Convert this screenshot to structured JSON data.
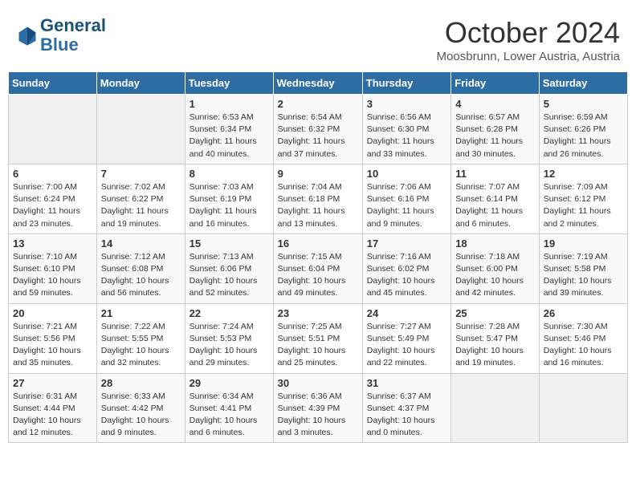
{
  "header": {
    "logo_line1": "General",
    "logo_line2": "Blue",
    "month": "October 2024",
    "location": "Moosbrunn, Lower Austria, Austria"
  },
  "days_of_week": [
    "Sunday",
    "Monday",
    "Tuesday",
    "Wednesday",
    "Thursday",
    "Friday",
    "Saturday"
  ],
  "weeks": [
    [
      {
        "day": "",
        "info": ""
      },
      {
        "day": "",
        "info": ""
      },
      {
        "day": "1",
        "info": "Sunrise: 6:53 AM\nSunset: 6:34 PM\nDaylight: 11 hours and 40 minutes."
      },
      {
        "day": "2",
        "info": "Sunrise: 6:54 AM\nSunset: 6:32 PM\nDaylight: 11 hours and 37 minutes."
      },
      {
        "day": "3",
        "info": "Sunrise: 6:56 AM\nSunset: 6:30 PM\nDaylight: 11 hours and 33 minutes."
      },
      {
        "day": "4",
        "info": "Sunrise: 6:57 AM\nSunset: 6:28 PM\nDaylight: 11 hours and 30 minutes."
      },
      {
        "day": "5",
        "info": "Sunrise: 6:59 AM\nSunset: 6:26 PM\nDaylight: 11 hours and 26 minutes."
      }
    ],
    [
      {
        "day": "6",
        "info": "Sunrise: 7:00 AM\nSunset: 6:24 PM\nDaylight: 11 hours and 23 minutes."
      },
      {
        "day": "7",
        "info": "Sunrise: 7:02 AM\nSunset: 6:22 PM\nDaylight: 11 hours and 19 minutes."
      },
      {
        "day": "8",
        "info": "Sunrise: 7:03 AM\nSunset: 6:19 PM\nDaylight: 11 hours and 16 minutes."
      },
      {
        "day": "9",
        "info": "Sunrise: 7:04 AM\nSunset: 6:18 PM\nDaylight: 11 hours and 13 minutes."
      },
      {
        "day": "10",
        "info": "Sunrise: 7:06 AM\nSunset: 6:16 PM\nDaylight: 11 hours and 9 minutes."
      },
      {
        "day": "11",
        "info": "Sunrise: 7:07 AM\nSunset: 6:14 PM\nDaylight: 11 hours and 6 minutes."
      },
      {
        "day": "12",
        "info": "Sunrise: 7:09 AM\nSunset: 6:12 PM\nDaylight: 11 hours and 2 minutes."
      }
    ],
    [
      {
        "day": "13",
        "info": "Sunrise: 7:10 AM\nSunset: 6:10 PM\nDaylight: 10 hours and 59 minutes."
      },
      {
        "day": "14",
        "info": "Sunrise: 7:12 AM\nSunset: 6:08 PM\nDaylight: 10 hours and 56 minutes."
      },
      {
        "day": "15",
        "info": "Sunrise: 7:13 AM\nSunset: 6:06 PM\nDaylight: 10 hours and 52 minutes."
      },
      {
        "day": "16",
        "info": "Sunrise: 7:15 AM\nSunset: 6:04 PM\nDaylight: 10 hours and 49 minutes."
      },
      {
        "day": "17",
        "info": "Sunrise: 7:16 AM\nSunset: 6:02 PM\nDaylight: 10 hours and 45 minutes."
      },
      {
        "day": "18",
        "info": "Sunrise: 7:18 AM\nSunset: 6:00 PM\nDaylight: 10 hours and 42 minutes."
      },
      {
        "day": "19",
        "info": "Sunrise: 7:19 AM\nSunset: 5:58 PM\nDaylight: 10 hours and 39 minutes."
      }
    ],
    [
      {
        "day": "20",
        "info": "Sunrise: 7:21 AM\nSunset: 5:56 PM\nDaylight: 10 hours and 35 minutes."
      },
      {
        "day": "21",
        "info": "Sunrise: 7:22 AM\nSunset: 5:55 PM\nDaylight: 10 hours and 32 minutes."
      },
      {
        "day": "22",
        "info": "Sunrise: 7:24 AM\nSunset: 5:53 PM\nDaylight: 10 hours and 29 minutes."
      },
      {
        "day": "23",
        "info": "Sunrise: 7:25 AM\nSunset: 5:51 PM\nDaylight: 10 hours and 25 minutes."
      },
      {
        "day": "24",
        "info": "Sunrise: 7:27 AM\nSunset: 5:49 PM\nDaylight: 10 hours and 22 minutes."
      },
      {
        "day": "25",
        "info": "Sunrise: 7:28 AM\nSunset: 5:47 PM\nDaylight: 10 hours and 19 minutes."
      },
      {
        "day": "26",
        "info": "Sunrise: 7:30 AM\nSunset: 5:46 PM\nDaylight: 10 hours and 16 minutes."
      }
    ],
    [
      {
        "day": "27",
        "info": "Sunrise: 6:31 AM\nSunset: 4:44 PM\nDaylight: 10 hours and 12 minutes."
      },
      {
        "day": "28",
        "info": "Sunrise: 6:33 AM\nSunset: 4:42 PM\nDaylight: 10 hours and 9 minutes."
      },
      {
        "day": "29",
        "info": "Sunrise: 6:34 AM\nSunset: 4:41 PM\nDaylight: 10 hours and 6 minutes."
      },
      {
        "day": "30",
        "info": "Sunrise: 6:36 AM\nSunset: 4:39 PM\nDaylight: 10 hours and 3 minutes."
      },
      {
        "day": "31",
        "info": "Sunrise: 6:37 AM\nSunset: 4:37 PM\nDaylight: 10 hours and 0 minutes."
      },
      {
        "day": "",
        "info": ""
      },
      {
        "day": "",
        "info": ""
      }
    ]
  ]
}
